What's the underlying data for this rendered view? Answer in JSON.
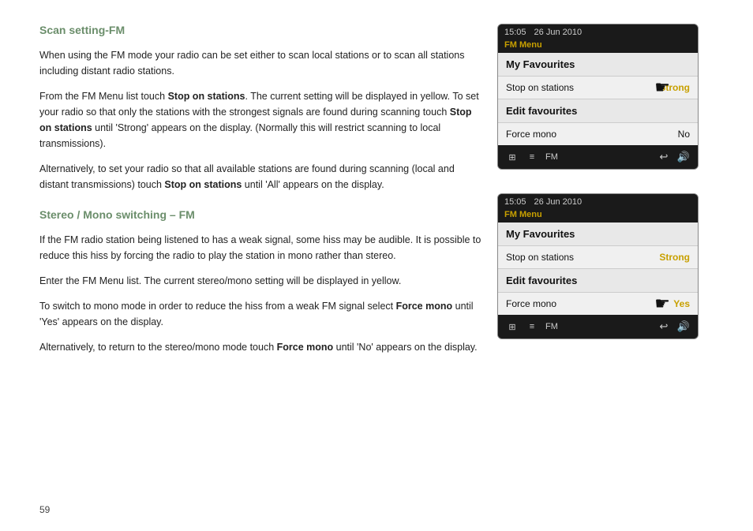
{
  "page": {
    "number": "59",
    "sections": [
      {
        "id": "scan-setting-fm",
        "title": "Scan setting-FM",
        "paragraphs": [
          "When using the FM mode your radio can be set either to scan local stations or to scan all stations including distant radio stations.",
          "From the FM Menu list touch Stop on stations. The current setting will be displayed in yellow. To set your radio so that only the stations with the strongest signals are found during scanning touch Stop on stations until 'Strong' appears on the display. (Normally this will restrict scanning to local transmissions).",
          "Alternatively, to set your radio so that all available stations are found during scanning (local and distant transmissions) touch Stop on stations until 'All' appears on the display."
        ]
      },
      {
        "id": "stereo-mono-fm",
        "title": "Stereo / Mono switching – FM",
        "paragraphs": [
          "If the FM radio station being listened to has a weak signal, some hiss may be audible. It is possible to reduce this hiss by forcing the radio to play the station in mono rather than stereo.",
          "Enter the FM Menu list. The current stereo/mono setting will be displayed in yellow.",
          "To switch to mono mode in order to reduce the hiss from a weak FM signal select Force mono until 'Yes' appears on the display.",
          "Alternatively, to return to the stereo/mono mode touch Force mono until 'No' appears on the display."
        ]
      }
    ]
  },
  "panel1": {
    "status_time": "15:05",
    "status_date": "26 Jun 2010",
    "menu_label": "FM Menu",
    "items": [
      {
        "label": "My Favourites",
        "value": "",
        "type": "header"
      },
      {
        "label": "Stop on stations",
        "value": "Strong",
        "type": "strong"
      },
      {
        "label": "Edit favourites",
        "value": "",
        "type": "header"
      },
      {
        "label": "Force mono",
        "value": "No",
        "type": "plain"
      }
    ],
    "bottom": {
      "fm_label": "FM",
      "icons": [
        "grid",
        "menu",
        "back",
        "volume"
      ]
    }
  },
  "panel2": {
    "status_time": "15:05",
    "status_date": "26 Jun 2010",
    "menu_label": "FM Menu",
    "items": [
      {
        "label": "My Favourites",
        "value": "",
        "type": "header"
      },
      {
        "label": "Stop on stations",
        "value": "Strong",
        "type": "strong"
      },
      {
        "label": "Edit favourites",
        "value": "",
        "type": "header"
      },
      {
        "label": "Force mono",
        "value": "Yes",
        "type": "yes"
      }
    ],
    "bottom": {
      "fm_label": "FM",
      "icons": [
        "grid",
        "menu",
        "back",
        "volume"
      ]
    }
  },
  "labels": {
    "scan_title": "Scan setting-FM",
    "stereo_title": "Stereo / Mono switching – FM",
    "para1_1": "When using the FM mode your radio can be set either to scan local stations or to scan all stations including distant radio stations.",
    "para1_2a": "From the FM Menu list touch ",
    "para1_2_bold1": "Stop on stations",
    "para1_2b": ". The current setting will be displayed in yellow. To set your radio so that only the stations with the strongest signals are found during scanning touch ",
    "para1_2_bold2": "Stop on stations",
    "para1_2c": " until 'Strong' appears on the display. (Normally this will restrict scanning to local transmissions).",
    "para1_3a": "Alternatively, to set your radio so that all available stations are found during scanning (local and distant transmissions) touch ",
    "para1_3_bold": "Stop on stations",
    "para1_3b": " until 'All' appears on the display.",
    "para2_1": "If the FM radio station being listened to has a weak signal, some hiss may be audible. It is possible to reduce this hiss by forcing the radio to play the station in mono rather than stereo.",
    "para2_2": "Enter the FM Menu list. The current stereo/mono setting will be displayed in yellow.",
    "para2_3a": "To switch to mono mode in order to reduce the hiss from a weak FM signal select ",
    "para2_3_bold": "Force mono",
    "para2_3b": " until 'Yes' appears on the display.",
    "para2_4a": "Alternatively, to return to the stereo/mono mode touch ",
    "para2_4_bold": "Force mono",
    "para2_4b": " until 'No' appears on the display."
  }
}
